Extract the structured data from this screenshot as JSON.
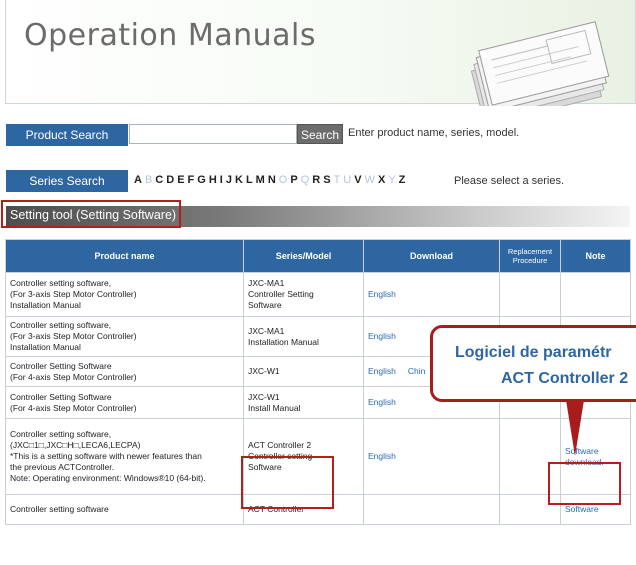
{
  "header": {
    "title": "Operation Manuals"
  },
  "product_search": {
    "label": "Product Search",
    "button": "Search",
    "hint": "Enter product name, series, model."
  },
  "series_search": {
    "label": "Series Search",
    "letters": [
      {
        "ch": "A",
        "on": true
      },
      {
        "ch": "B",
        "on": false
      },
      {
        "ch": "C",
        "on": true
      },
      {
        "ch": "D",
        "on": true
      },
      {
        "ch": "E",
        "on": true
      },
      {
        "ch": "F",
        "on": true
      },
      {
        "ch": "G",
        "on": true
      },
      {
        "ch": "H",
        "on": true
      },
      {
        "ch": "I",
        "on": true
      },
      {
        "ch": "J",
        "on": true
      },
      {
        "ch": "K",
        "on": true
      },
      {
        "ch": "L",
        "on": true
      },
      {
        "ch": "M",
        "on": true
      },
      {
        "ch": "N",
        "on": true
      },
      {
        "ch": "O",
        "on": false
      },
      {
        "ch": "P",
        "on": true
      },
      {
        "ch": "Q",
        "on": false
      },
      {
        "ch": "R",
        "on": true
      },
      {
        "ch": "S",
        "on": true
      },
      {
        "ch": "T",
        "on": false
      },
      {
        "ch": "U",
        "on": false
      },
      {
        "ch": "V",
        "on": true
      },
      {
        "ch": "W",
        "on": false
      },
      {
        "ch": "X",
        "on": true
      },
      {
        "ch": "Y",
        "on": false
      },
      {
        "ch": "Z",
        "on": true
      }
    ],
    "hint": "Please select a series."
  },
  "section": {
    "title": "Setting tool (Setting Software)"
  },
  "table": {
    "headers": [
      "Product name",
      "Series/Model",
      "Download",
      "Replacement Procedure",
      "Note"
    ],
    "rows": [
      {
        "name": [
          "Controller setting software,",
          "(For 3-axis Step Motor Controller)",
          "Installation Manual"
        ],
        "series": [
          "JXC-MA1",
          "Controller Setting",
          "Software"
        ],
        "download": "English",
        "note": ""
      },
      {
        "name": [
          "Controller setting software,",
          "(For 3-axis Step Motor Controller)",
          "Installation Manual"
        ],
        "series": [
          "JXC-MA1",
          "Installation Manual"
        ],
        "download": "English",
        "note": ""
      },
      {
        "name": [
          "Controller Setting Software",
          "(For 4-axis Step Motor Controller)"
        ],
        "series": [
          "JXC-W1"
        ],
        "download": "English",
        "download2": "Chin",
        "note": ""
      },
      {
        "name": [
          "Controller Setting Software",
          "(For 4-axis Step Motor Controller)"
        ],
        "series": [
          "JXC-W1",
          "Install Manual"
        ],
        "download": "English",
        "note": ""
      },
      {
        "name": [
          "Controller setting software,",
          "(JXC□1□,JXC□H□,LECA6,LECPA)",
          "*This is a setting software with newer features than",
          "the previous ACTController.",
          "Note: Operating environment: Windows®10 (64-bit)."
        ],
        "series": [
          "ACT Controller 2",
          "Controller setting",
          "Software"
        ],
        "download": "English",
        "note": "Software download."
      },
      {
        "name": [
          "Controller setting software"
        ],
        "series": [
          "ACT Controller"
        ],
        "download": "",
        "note": "Software"
      }
    ]
  },
  "callout": {
    "line1": "Logiciel de paramétr",
    "line2": "ACT Controller 2"
  }
}
